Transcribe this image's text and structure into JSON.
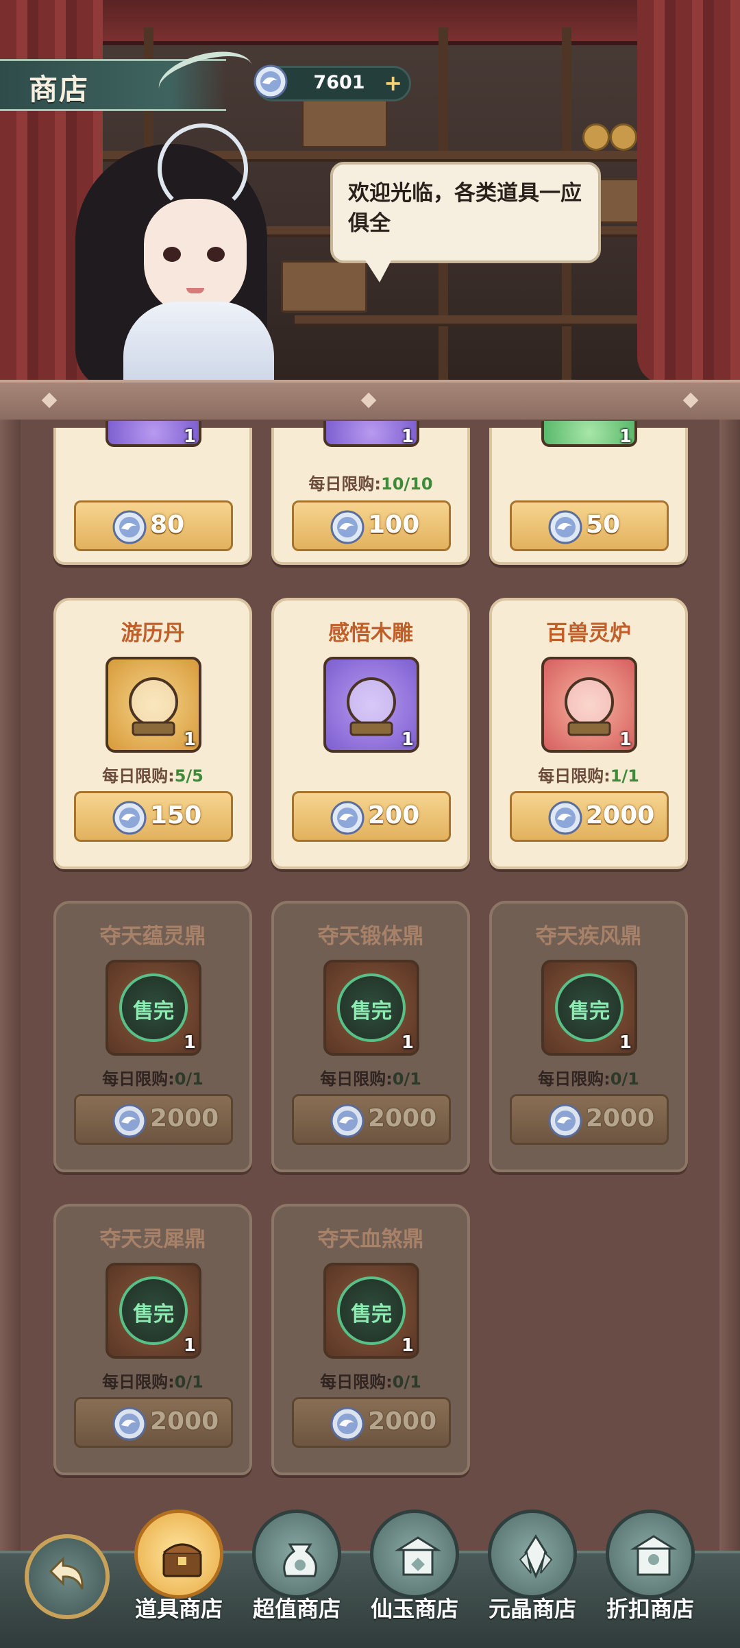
{
  "header": {
    "title": "商店",
    "currency": {
      "icon": "spirit-jade-coin-icon",
      "value": "7601",
      "add_label": "+"
    }
  },
  "npc": {
    "speech": "欢迎光临，各类道具一应俱全"
  },
  "shop": {
    "limit_prefix": "每日限购:",
    "partial_row": [
      {
        "icon_color": "purple",
        "quantity": "1",
        "limit": "",
        "price": "80"
      },
      {
        "icon_color": "purple",
        "quantity": "1",
        "limit": "10/10",
        "price": "100"
      },
      {
        "icon_color": "green",
        "quantity": "1",
        "limit": "",
        "price": "50"
      }
    ],
    "items": [
      {
        "name": "游历丹",
        "icon": "crystal-ball-icon",
        "icon_color": "gold",
        "quantity": "1",
        "limit": "5/5",
        "price": "150",
        "sold_out": false
      },
      {
        "name": "感悟木雕",
        "icon": "wood-carving-icon",
        "icon_color": "purple",
        "quantity": "1",
        "limit": "",
        "price": "200",
        "sold_out": false
      },
      {
        "name": "百兽灵炉",
        "icon": "beast-furnace-icon",
        "icon_color": "red",
        "quantity": "1",
        "limit": "1/1",
        "price": "2000",
        "sold_out": false
      },
      {
        "name": "夺天蕴灵鼎",
        "icon": "cauldron-icon",
        "icon_color": "brown",
        "quantity": "1",
        "limit": "0/1",
        "price": "2000",
        "sold_out": true
      },
      {
        "name": "夺天锻体鼎",
        "icon": "cauldron-icon",
        "icon_color": "brown",
        "quantity": "1",
        "limit": "0/1",
        "price": "2000",
        "sold_out": true
      },
      {
        "name": "夺天疾风鼎",
        "icon": "cauldron-icon",
        "icon_color": "brown",
        "quantity": "1",
        "limit": "0/1",
        "price": "2000",
        "sold_out": true
      },
      {
        "name": "夺天灵犀鼎",
        "icon": "cauldron-icon",
        "icon_color": "brown",
        "quantity": "1",
        "limit": "0/1",
        "price": "2000",
        "sold_out": true
      },
      {
        "name": "夺天血煞鼎",
        "icon": "cauldron-icon",
        "icon_color": "brown",
        "quantity": "1",
        "limit": "0/1",
        "price": "2000",
        "sold_out": true
      }
    ],
    "sold_out_label": "售完"
  },
  "bottom_nav": {
    "back_icon": "back-arrow-icon",
    "tabs": [
      {
        "label": "道具商店",
        "icon": "treasure-chest-icon",
        "active": true
      },
      {
        "label": "超值商店",
        "icon": "money-bag-icon",
        "active": false
      },
      {
        "label": "仙玉商店",
        "icon": "pavilion-icon",
        "active": false
      },
      {
        "label": "元晶商店",
        "icon": "crystal-icon",
        "active": false
      },
      {
        "label": "折扣商店",
        "icon": "shop-house-icon",
        "active": false
      }
    ]
  },
  "colors": {
    "price_button": "#e2b25e",
    "limit_value": "#3f8a3a",
    "item_name": "#c05f29",
    "active_tab": "#e8a941"
  }
}
